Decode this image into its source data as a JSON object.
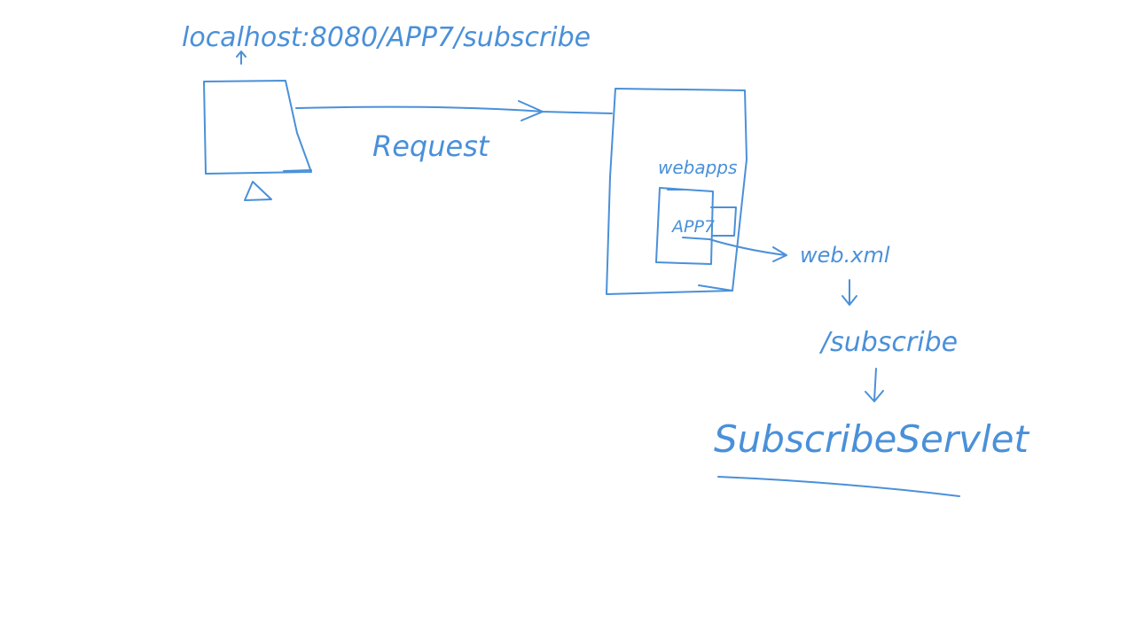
{
  "url_text": "localhost:8080/APP7/subscribe",
  "request_label": "Request",
  "webapp_label": "webapps",
  "app_label": "APP7",
  "webxml_label": "web.xml",
  "path_label": "/subscribe",
  "servlet_label": "SubscribeServlet",
  "ink_color": "#4a90d9"
}
